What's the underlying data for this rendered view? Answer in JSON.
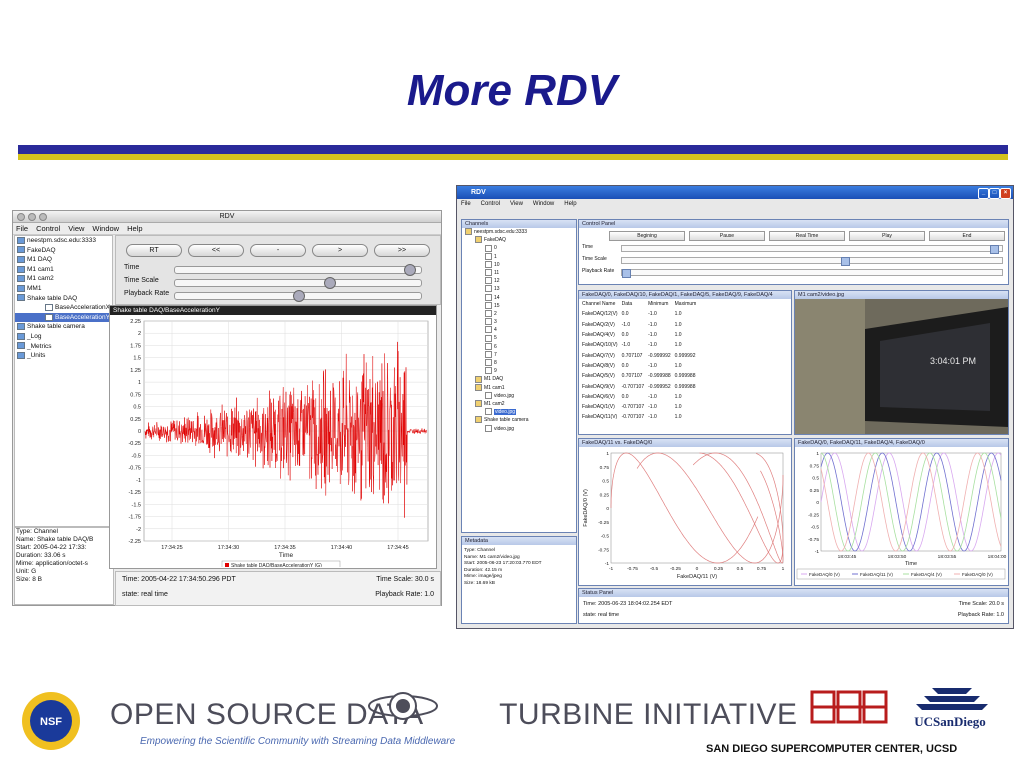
{
  "slide": {
    "title": "More RDV",
    "brand_left": "OPEN SOURCE DATA",
    "brand_right": "TURBINE INITIATIVE",
    "tagline": "Empowering the Scientific Community with Streaming Data Middleware",
    "footer": "SAN DIEGO SUPERCOMPUTER CENTER, UCSD",
    "nsf_label": "NSF",
    "ucsd_logo_text": "UCSanDiego",
    "colors": {
      "title": "#1a1a8c",
      "rule_blue": "#2a2a9a",
      "rule_gold": "#d4c21c"
    }
  },
  "left_window": {
    "title": "RDV",
    "menu": [
      "File",
      "Control",
      "View",
      "Window",
      "Help"
    ],
    "tree": [
      {
        "label": "neestpm.sdsc.edu:3333",
        "indent": 0
      },
      {
        "label": "FakeDAQ",
        "indent": 0
      },
      {
        "label": "M1 DAQ",
        "indent": 0
      },
      {
        "label": "M1 cam1",
        "indent": 0
      },
      {
        "label": "M1 cam2",
        "indent": 0
      },
      {
        "label": "MM1",
        "indent": 0
      },
      {
        "label": "Shake table DAQ",
        "indent": 0
      },
      {
        "label": "BaseAccelerationX",
        "indent": 2
      },
      {
        "label": "BaseAccelerationY",
        "indent": 2,
        "selected": true
      },
      {
        "label": "Shake table camera",
        "indent": 0
      },
      {
        "label": "_Log",
        "indent": 0
      },
      {
        "label": "_Metrics",
        "indent": 0
      },
      {
        "label": "_Units",
        "indent": 0
      }
    ],
    "metadata": [
      "Type: Channel",
      "Name: Shake table DAQ/B",
      "Start: 2005-04-22 17:33:",
      "Duration: 33.06 s",
      "Mime: application/octet-s",
      "Unit: G",
      "Size: 8 B"
    ],
    "buttons": [
      "RT",
      "<<",
      "-",
      ">",
      ">>"
    ],
    "sliders": [
      {
        "label": "Time",
        "level": 0.97
      },
      {
        "label": "Time Scale",
        "level": 0.63
      },
      {
        "label": "Playback Rate",
        "level": 0.5
      }
    ],
    "plot_title": "Shake table DAQ/BaseAccelerationY",
    "status_time": "Time: 2005-04-22 17:34:50.296 PDT",
    "status_state": "state: real time",
    "status_scale": "Time Scale: 30.0 s",
    "status_rate": "Playback Rate: 1.0"
  },
  "right_window": {
    "title": "RDV",
    "menu": [
      "File",
      "Control",
      "View",
      "Window",
      "Help"
    ],
    "channels_header": "Channels",
    "tree": [
      {
        "label": "neestpm.sdsc.edu:3333",
        "indent": 0
      },
      {
        "label": "FakeDAQ",
        "indent": 1
      },
      {
        "label": "0",
        "indent": 2
      },
      {
        "label": "1",
        "indent": 2
      },
      {
        "label": "10",
        "indent": 2
      },
      {
        "label": "11",
        "indent": 2
      },
      {
        "label": "12",
        "indent": 2
      },
      {
        "label": "13",
        "indent": 2
      },
      {
        "label": "14",
        "indent": 2
      },
      {
        "label": "15",
        "indent": 2
      },
      {
        "label": "2",
        "indent": 2
      },
      {
        "label": "3",
        "indent": 2
      },
      {
        "label": "4",
        "indent": 2
      },
      {
        "label": "5",
        "indent": 2
      },
      {
        "label": "6",
        "indent": 2
      },
      {
        "label": "7",
        "indent": 2
      },
      {
        "label": "8",
        "indent": 2
      },
      {
        "label": "9",
        "indent": 2
      },
      {
        "label": "M1 DAQ",
        "indent": 1
      },
      {
        "label": "M1 cam1",
        "indent": 1
      },
      {
        "label": "video.jpg",
        "indent": 2
      },
      {
        "label": "M1 cam2",
        "indent": 1
      },
      {
        "label": "video.jpg",
        "indent": 2,
        "selected": true
      },
      {
        "label": "Shake table camera",
        "indent": 1
      },
      {
        "label": "video.jpg",
        "indent": 2
      }
    ],
    "metadata_header": "Metadata",
    "metadata": [
      "Type: Channel",
      "Name: M1 cam2/video.jpg",
      "Start: 2005-06-23 17:20:03.770 EDT",
      "Duration: 42.15 m",
      "Mime: image/jpeg",
      "Size: 18.69 kB"
    ],
    "control_header": "Control Panel",
    "buttons": [
      "Begining",
      "Pause",
      "Real Time",
      "Play",
      "End"
    ],
    "sliders": [
      {
        "label": "Time",
        "level": 0.99
      },
      {
        "label": "Time Scale",
        "level": 0.59
      },
      {
        "label": "Playback Rate",
        "level": 0.0
      }
    ],
    "table_header": "FakeDAQ/0, FakeDAQ/10, FakeDAQ/1, FakeDAQ/5, FakeDAQ/9, FakeDAQ/4",
    "table": {
      "columns": [
        "Channel Name",
        "Data",
        "Minimum",
        "Maximum"
      ],
      "rows": [
        [
          "FakeDAQ/12(V)",
          "0.0",
          "-1.0",
          "1.0"
        ],
        [
          "FakeDAQ/2(V)",
          "-1.0",
          "-1.0",
          "1.0"
        ],
        [
          "FakeDAQ/4(V)",
          "0.0",
          "-1.0",
          "1.0"
        ],
        [
          "FakeDAQ/10(V)",
          "-1.0",
          "-1.0",
          "1.0"
        ],
        [
          "FakeDAQ/7(V)",
          "0.707107",
          "-0.999992",
          "0.999992"
        ],
        [
          "FakeDAQ/8(V)",
          "0.0",
          "-1.0",
          "1.0"
        ],
        [
          "FakeDAQ/5(V)",
          "0.707107",
          "-0.999988",
          "0.999988"
        ],
        [
          "FakeDAQ/9(V)",
          "-0.707107",
          "-0.999952",
          "0.999988"
        ],
        [
          "FakeDAQ/6(V)",
          "0.0",
          "-1.0",
          "1.0"
        ],
        [
          "FakeDAQ/1(V)",
          "-0.707107",
          "-1.0",
          "1.0"
        ],
        [
          "FakeDAQ/11(V)",
          "-0.707107",
          "-1.0",
          "1.0"
        ]
      ]
    },
    "video_header": "M1 cam2/video.jpg",
    "video_overlay": "3:04:01 PM",
    "xy_header": "FakeDAQ/11 vs. FakeDAQ/0",
    "ts_header": "FakeDAQ/0, FakeDAQ/11, FakeDAQ/4, FakeDAQ/0",
    "status_header": "Status Panel",
    "status_time": "Time: 2005-06-23 18:04:02.254 EDT",
    "status_state": "state: real time",
    "status_scale": "Time Scale: 20.0 s",
    "status_rate": "Playback Rate: 1.0"
  },
  "chart_data": [
    {
      "type": "line",
      "title": "Shake table DAQ/BaseAccelerationY",
      "xlabel": "Time",
      "ylabel": "",
      "x_ticks": [
        "17:34:25",
        "17:34:30",
        "17:34:35",
        "17:34:40",
        "17:34:45",
        "17:34:5"
      ],
      "y_ticks": [
        2.25,
        2.0,
        1.75,
        1.5,
        1.25,
        1.0,
        0.75,
        0.5,
        0.25,
        0.0,
        -0.25,
        -0.5,
        -0.75,
        -1.0,
        -1.25,
        -1.5,
        -1.75,
        -2.0,
        -2.25
      ],
      "ylim": [
        -2.25,
        2.25
      ],
      "series": [
        {
          "name": "Shake table DAQ/BaseAccelerationY (G)",
          "color": "#e00000"
        }
      ]
    },
    {
      "type": "line",
      "title": "FakeDAQ/11 vs. FakeDAQ/0",
      "xlabel": "FakeDAQ/11 (V)",
      "ylabel": "FakeDAQ/0 (V)",
      "x_ticks": [
        -1.0,
        -0.75,
        -0.5,
        -0.25,
        0.0,
        0.25,
        0.5,
        0.75,
        1.0
      ],
      "y_ticks": [
        1.0,
        0.75,
        0.5,
        0.25,
        0.0,
        -0.25,
        -0.5,
        -0.75,
        -1.0
      ],
      "xlim": [
        -1.0,
        1.0
      ],
      "ylim": [
        -1.0,
        1.0
      ]
    },
    {
      "type": "line",
      "title": "FakeDAQ/0, FakeDAQ/11, FakeDAQ/4, FakeDAQ/0",
      "xlabel": "Time",
      "ylabel": "",
      "x_ticks": [
        "18:03:45",
        "18:03:50",
        "18:03:55",
        "18:04:00"
      ],
      "y_ticks": [
        1.0,
        0.75,
        0.5,
        0.25,
        0.0,
        -0.25,
        -0.5,
        -0.75,
        -1.0
      ],
      "ylim": [
        -1.0,
        1.0
      ],
      "series": [
        {
          "name": "FakeDAQ/0 (V)",
          "color": "#d8a8f0"
        },
        {
          "name": "FakeDAQ/11 (V)",
          "color": "#7070d0"
        },
        {
          "name": "FakeDAQ/4 (V)",
          "color": "#a8e0a0"
        },
        {
          "name": "FakeDAQ/0 (V)",
          "color": "#f0b0b0"
        }
      ]
    }
  ]
}
